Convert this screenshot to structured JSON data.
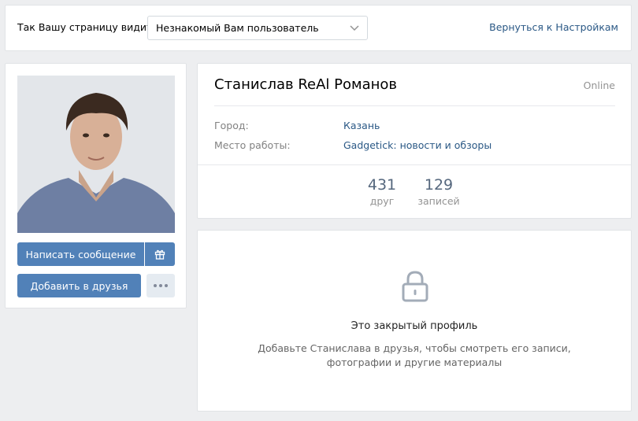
{
  "topbar": {
    "label": "Так Вашу страницу видит",
    "viewer_select": "Незнакомый Вам пользователь",
    "back_link": "Вернуться к Настройкам"
  },
  "profile": {
    "name": "Станислав ReAl Романов",
    "status": "Online",
    "rows": [
      {
        "label": "Город:",
        "value": "Казань"
      },
      {
        "label": "Место работы:",
        "value": "Gadgetick: новости и обзоры"
      }
    ],
    "counters": [
      {
        "num": "431",
        "label": "друг"
      },
      {
        "num": "129",
        "label": "записей"
      }
    ]
  },
  "actions": {
    "message": "Написать сообщение",
    "add_friend": "Добавить в друзья",
    "gift_icon": "gift-icon",
    "more_icon": "more-icon"
  },
  "closed": {
    "title": "Это закрытый профиль",
    "description": "Добавьте Станислава в друзья, чтобы смотреть его записи, фотографии и другие материалы"
  },
  "colors": {
    "background": "#edeef0",
    "accent": "#5181b8",
    "link": "#2a5885"
  }
}
